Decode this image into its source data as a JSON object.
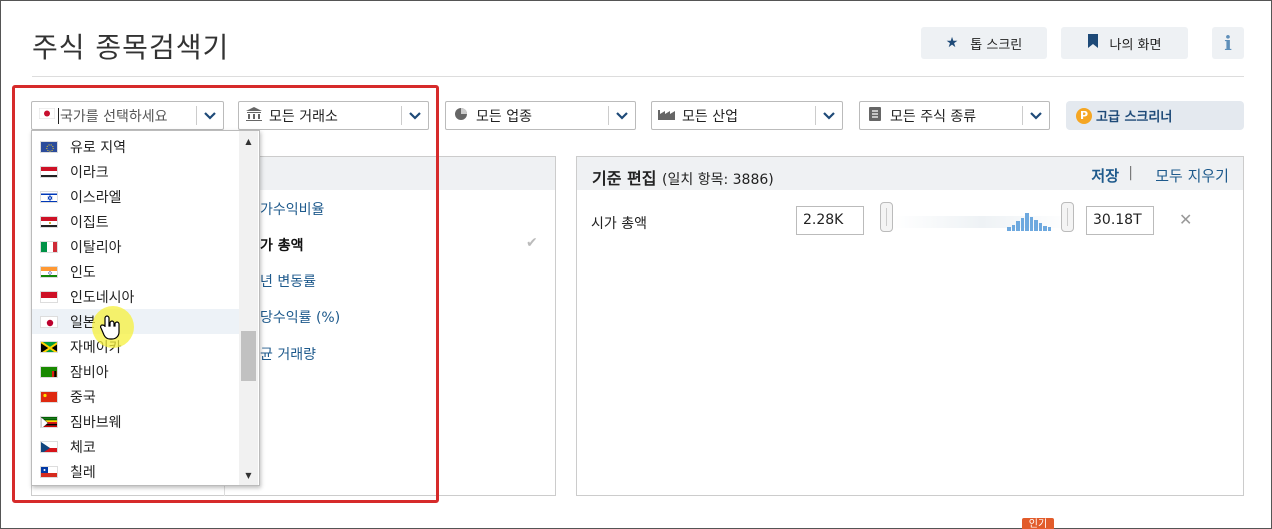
{
  "header": {
    "title": "주식 종목검색기",
    "top_screens_label": "톱 스크린",
    "my_screens_label": "나의 화면",
    "info_glyph": "i"
  },
  "filters": {
    "country_placeholder": "국가를 선택하세요",
    "exchange": "모든 거래소",
    "sector": "모든 업종",
    "industry": "모든 산업",
    "stock_type": "모든 주식 종류",
    "advanced_label": "고급 스크리너",
    "advanced_badge": "P"
  },
  "criteria": {
    "items": [
      "가수익비율",
      "가 총액",
      "년 변동률",
      "당수익률 (%)",
      "균 거래량"
    ],
    "selected_index": 1
  },
  "edit_panel": {
    "title": "기준 편집",
    "match_text": "(일치 항목: 3886)",
    "save_label": "저장",
    "separator": "|",
    "clear_label": "모두 지우기",
    "row_label": "시가 총액",
    "min_value": "2.28K",
    "max_value": "30.18T",
    "remove_glyph": "✕"
  },
  "country_dropdown": {
    "items": [
      {
        "label": "유로 지역",
        "flag": "eu"
      },
      {
        "label": "이라크",
        "flag": "iraq"
      },
      {
        "label": "이스라엘",
        "flag": "israel"
      },
      {
        "label": "이집트",
        "flag": "egypt"
      },
      {
        "label": "이탈리아",
        "flag": "italy"
      },
      {
        "label": "인도",
        "flag": "india"
      },
      {
        "label": "인도네시아",
        "flag": "indonesia"
      },
      {
        "label": "일본",
        "flag": "japan"
      },
      {
        "label": "자메이카",
        "flag": "jamaica"
      },
      {
        "label": "잠비아",
        "flag": "zambia"
      },
      {
        "label": "중국",
        "flag": "china"
      },
      {
        "label": "짐바브웨",
        "flag": "zimbabwe"
      },
      {
        "label": "체코",
        "flag": "czech"
      },
      {
        "label": "칠레",
        "flag": "chile"
      }
    ],
    "hovered": "일본"
  },
  "footer": {
    "badge": "인기"
  },
  "colors": {
    "accent": "#1e4a78",
    "link": "#1e5a8c",
    "highlight_box": "#d62a2a",
    "histogram": "#6ea9df"
  }
}
